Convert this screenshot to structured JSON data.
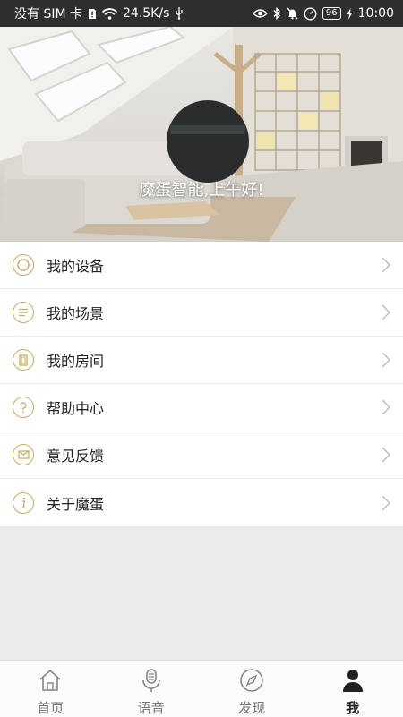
{
  "status_bar": {
    "sim_text": "没有 SIM 卡",
    "net_speed": "24.5K/s",
    "battery": "96",
    "time": "10:00"
  },
  "hero": {
    "greeting": "魔蛋智能,上午好!"
  },
  "menu": {
    "items": [
      {
        "label": "我的设备",
        "icon": "device-circle-icon"
      },
      {
        "label": "我的场景",
        "icon": "scene-list-icon"
      },
      {
        "label": "我的房间",
        "icon": "room-door-icon"
      },
      {
        "label": "帮助中心",
        "icon": "help-question-icon"
      },
      {
        "label": "意见反馈",
        "icon": "feedback-mail-icon"
      },
      {
        "label": "关于魔蛋",
        "icon": "info-icon"
      }
    ]
  },
  "tabbar": {
    "tabs": [
      {
        "label": "首页",
        "icon": "home-icon"
      },
      {
        "label": "语音",
        "icon": "microphone-icon"
      },
      {
        "label": "发现",
        "icon": "compass-icon"
      },
      {
        "label": "我",
        "icon": "person-icon"
      }
    ],
    "active": "我"
  },
  "colors": {
    "accent_gold": "#c8aa64",
    "status_bar_bg": "#2e2e2e",
    "page_bg": "#ebebeb"
  }
}
